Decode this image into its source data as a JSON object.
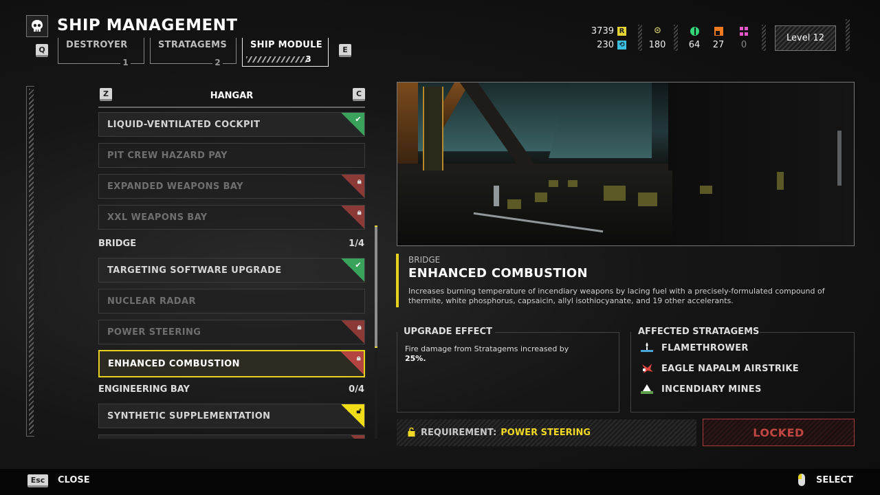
{
  "header": {
    "title": "SHIP MANAGEMENT",
    "prev_key": "Q",
    "next_key": "E",
    "tabs": [
      {
        "label": "DESTROYER",
        "number": "1",
        "active": false
      },
      {
        "label": "STRATAGEMS",
        "number": "2",
        "active": false
      },
      {
        "label": "SHIP MODULE",
        "number": "3",
        "active": true
      }
    ]
  },
  "resources": {
    "requisition": "3739",
    "requisition_icon": "R",
    "super_credits": "230",
    "medals": "180",
    "common_samples": "64",
    "rare_samples": "27",
    "super_samples": "0",
    "level": "Level 12",
    "colors": {
      "requisition": "#e5d233",
      "super_credits": "#3cc0e0",
      "medals": "#c9c36a",
      "common": "#33d67a",
      "rare": "#f07a22",
      "super": "#e657c9"
    }
  },
  "list": {
    "header": "HANGAR",
    "left_key": "Z",
    "right_key": "C",
    "hangar_items": [
      {
        "label": "LIQUID-VENTILATED COCKPIT",
        "status": "owned"
      },
      {
        "label": "PIT CREW HAZARD PAY",
        "status": "unavailable"
      },
      {
        "label": "EXPANDED WEAPONS BAY",
        "status": "locked"
      },
      {
        "label": "XXL WEAPONS BAY",
        "status": "locked"
      }
    ],
    "bridge": {
      "label": "BRIDGE",
      "count": "1/4",
      "items": [
        {
          "label": "TARGETING SOFTWARE UPGRADE",
          "status": "owned"
        },
        {
          "label": "NUCLEAR RADAR",
          "status": "unavailable"
        },
        {
          "label": "POWER STEERING",
          "status": "locked"
        },
        {
          "label": "ENHANCED COMBUSTION",
          "status": "locked",
          "selected": true
        }
      ]
    },
    "engineering": {
      "label": "ENGINEERING BAY",
      "count": "0/4",
      "items": [
        {
          "label": "SYNTHETIC SUPPLEMENTATION",
          "status": "unlockable"
        }
      ]
    }
  },
  "detail": {
    "category": "BRIDGE",
    "title": "ENHANCED COMBUSTION",
    "description": "Increases burning temperature of incendiary weapons by lacing fuel with a precisely-formulated compound of thermite, white phosphorus, capsaicin, allyl isothiocyanate, and 19 other accelerants.",
    "upgrade_effect_header": "UPGRADE EFFECT",
    "upgrade_effect_text": "Fire damage from Stratagems increased by",
    "upgrade_effect_value": "25%.",
    "affected_header": "AFFECTED STRATAGEMS",
    "affected": [
      {
        "label": "FLAMETHROWER",
        "icon": "flamethrower-icon"
      },
      {
        "label": "EAGLE NAPALM AIRSTRIKE",
        "icon": "eagle-icon"
      },
      {
        "label": "INCENDIARY MINES",
        "icon": "mines-icon"
      }
    ],
    "requirement_label": "REQUIREMENT:",
    "requirement_value": "POWER STEERING",
    "action_label": "LOCKED"
  },
  "footer": {
    "close_key": "Esc",
    "close_label": "CLOSE",
    "select_label": "SELECT"
  }
}
